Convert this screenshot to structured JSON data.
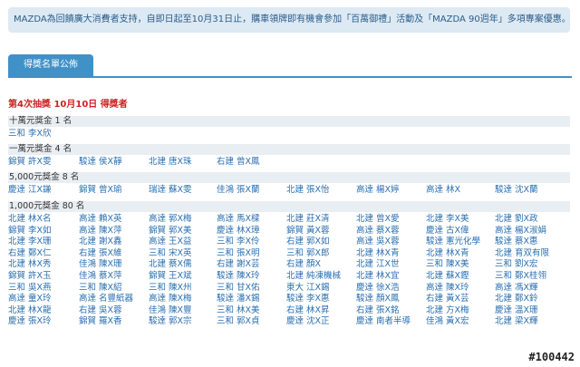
{
  "notice": "MAZDA為回饋廣大消費者支持，自即日起至10月31日止，購車領牌即有機會參加「百萬御禮」活動及「MAZDA 90週年」多項專案優惠。",
  "tab_label": "得獎名單公佈",
  "draw_title": "第4次抽獎 10月10日 得獎者",
  "prizes": [
    {
      "title": "十萬元獎金 1 名",
      "rows": [
        [
          "三和 李X欣"
        ]
      ]
    },
    {
      "title": "一萬元獎金 4 名",
      "rows": [
        [
          "錦賀 許X雯",
          "駿達 侯X靜",
          "北建 唐X珠",
          "右建 曾X鳳"
        ]
      ]
    },
    {
      "title": "5,000元獎金 8 名",
      "rows": [
        [
          "慶達 江X謙",
          "錦賀 曾X瑜",
          "瑞達 蘇X雯",
          "佳鴻 張X蘭",
          "北建 張X怡",
          "高達 楊X婷",
          "高達 林X",
          "駿達 沈X蘭"
        ]
      ]
    },
    {
      "title": "1,000元獎金 80 名",
      "rows": [
        [
          "北建 林X名",
          "高達 賴X英",
          "高達 郭X梅",
          "高達 馬X樑",
          "北建 莊X清",
          "北建 曾X愛",
          "北建 李X美",
          "北建 劉X政"
        ],
        [
          "錦賀 李X如",
          "高達 陳X萍",
          "錦賀 郭X美",
          "慶達 林X璋",
          "錦賀 黃X蓉",
          "高達 蔡X蓉",
          "慶達 古X偉",
          "高達 楊X淑娟"
        ],
        [
          "北建 李X珊",
          "北建 謝X鑫",
          "高達 王X益",
          "三和 李X伶",
          "右建 郭X如",
          "高達 吳X蓉",
          "駿達 憲光化學",
          "駿達 蔡X惠"
        ],
        [
          "右建 鄭X仁",
          "右建 張X維",
          "三和 宋X英",
          "三和 張X明",
          "三和 郭X郎",
          "北建 林X青",
          "北建 林X青",
          "北建 育双有限"
        ],
        [
          "北建 林X秀",
          "佳鴻 陳X珊",
          "北建 蔡X儒",
          "右建 謝X芸",
          "右建 顏X",
          "北建 江X世",
          "三和 陳X美",
          "三和 劉X宏"
        ],
        [
          "錦賀 許X玉",
          "佳鴻 蔡X萍",
          "錦賀 王X斌",
          "駿達 陳X玲",
          "北建 純凍機械",
          "北建 林X宜",
          "北建 蘇X鏗",
          "三和 鄭X桂翎"
        ],
        [
          "三和 吳X燕",
          "三和 陳X紹",
          "三和 陳X州",
          "三和 甘X佑",
          "東大 江X錫",
          "慶達 徐X浩",
          "高達 陳X玲",
          "高達 馮X輝"
        ],
        [
          "高達 童X玲",
          "高達 名豐紙器",
          "高達 陳X梅",
          "駿達 潘X錫",
          "駿達 李X惠",
          "駿達 顏X鳳",
          "右建 黃X芸",
          "北建 鄭X鈴"
        ],
        [
          "北建 林X龍",
          "右建 吳X蓉",
          "佳鴻 陳X豐",
          "三和 林X美",
          "右建 林X昇",
          "右建 張X銘",
          "北建 方X梅",
          "慶達 溫X珊"
        ],
        [
          "慶達 張X玲",
          "錦賀 羅X香",
          "駿達 郭X宗",
          "三和 郭X貞",
          "慶達 沈X正",
          "慶達 南者半導",
          "佳鴻 黃X宏",
          "北建 梁X輝"
        ]
      ]
    }
  ],
  "watermark": "#100442"
}
